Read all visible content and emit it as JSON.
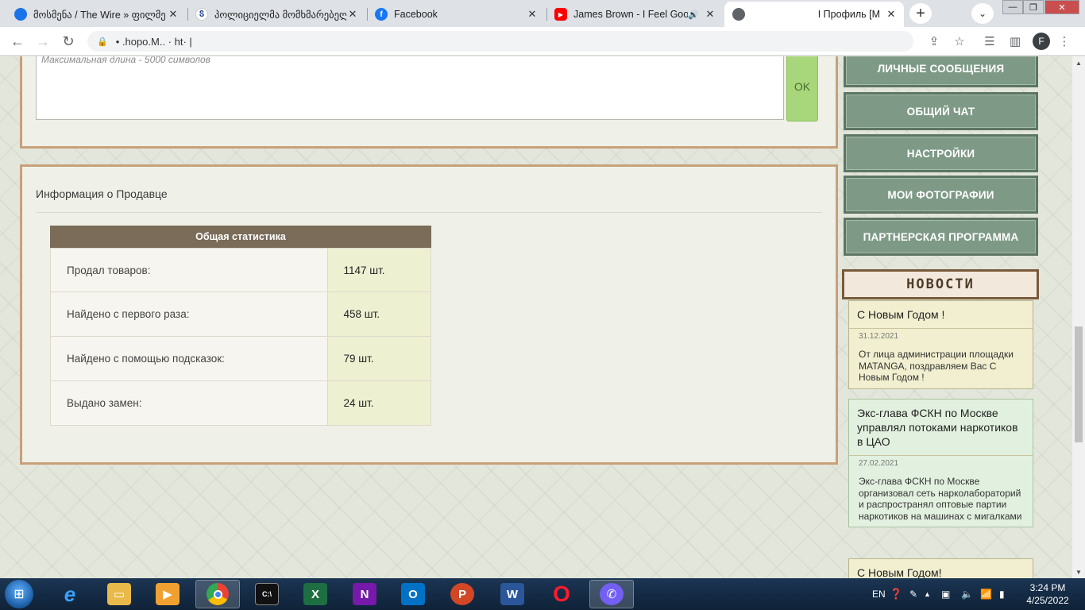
{
  "browser": {
    "tabs": [
      {
        "title": "მოსმენა / The Wire » ფილმე",
        "favicon_color": "#1a73e8",
        "favicon_glyph": "●"
      },
      {
        "title": "პოლიციელმა მომხმარებელ",
        "favicon_color": "#ffffff",
        "favicon_glyph": "Ⴝ"
      },
      {
        "title": "Facebook",
        "favicon_color": "#1877f2",
        "favicon_glyph": "f"
      },
      {
        "title": "James Brown - I Feel Good",
        "favicon_color": "#ff0000",
        "favicon_glyph": "▶"
      },
      {
        "title": "I Профиль [M",
        "favicon_color": "#5f6368",
        "favicon_glyph": "◍"
      }
    ],
    "tab_close_glyph": "✕",
    "audio_glyph": "🔊",
    "address": "• .hopo.M.. · ht· |",
    "new_tab_glyph": "+",
    "tab_search_glyph": "⌄",
    "profile_initial": "F",
    "window_controls": {
      "minimize": "—",
      "maximize": "❐",
      "close": "✕"
    }
  },
  "form": {
    "comment_placeholder": "Максимальная длина - 5000 символов",
    "ok_label": "OK"
  },
  "seller_info": {
    "title": "Информация о Продавце",
    "stats_header": "Общая статистика",
    "stats": [
      {
        "label": "Продал товаров:",
        "value": "1147 шт."
      },
      {
        "label": "Найдено с первого раза:",
        "value": "458 шт."
      },
      {
        "label": "Найдено с помощью подсказок:",
        "value": "79 шт."
      },
      {
        "label": "Выдано замен:",
        "value": "24 шт."
      }
    ]
  },
  "sidebar": {
    "menu": [
      {
        "label": "ЛИЧНЫЕ СООБЩЕНИЯ"
      },
      {
        "label": "ОБЩИЙ ЧАТ"
      },
      {
        "label": "НАСТРОЙКИ"
      },
      {
        "label": "МОИ ФОТОГРАФИИ"
      },
      {
        "label": "ПАРТНЕРСКАЯ ПРОГРАММА"
      }
    ],
    "news_title": "НОВОСТИ",
    "news": [
      {
        "title": "С Новым Годом !",
        "date": "31.12.2021",
        "text": "От лица администрации площадки MATANGA, поздравляем Вас С Новым Годом !"
      },
      {
        "title": "Экс-глава ФСКН по Москве управлял потоками наркотиков в ЦАО",
        "date": "27.02.2021",
        "text": "Экс-глава ФСКН по Москве организовал сеть нарколабораторий и распространял оптовые партии наркотиков на машинах с мигалками"
      },
      {
        "title": "С Новым Годом!",
        "date": "",
        "text": ""
      }
    ]
  },
  "taskbar": {
    "apps": [
      {
        "name": "internet-explorer",
        "color": "#1e88e5",
        "glyph": "e"
      },
      {
        "name": "file-explorer",
        "color": "#e9b949",
        "glyph": "▭"
      },
      {
        "name": "media-player",
        "color": "#f0a030",
        "glyph": "▶"
      },
      {
        "name": "chrome",
        "color": "#4285f4",
        "glyph": "◉"
      },
      {
        "name": "command-prompt",
        "color": "#111111",
        "glyph": "C:\\"
      },
      {
        "name": "excel",
        "color": "#1d6f42",
        "glyph": "X"
      },
      {
        "name": "onenote",
        "color": "#7719aa",
        "glyph": "N"
      },
      {
        "name": "outlook",
        "color": "#0072c6",
        "glyph": "O"
      },
      {
        "name": "powerpoint",
        "color": "#d24726",
        "glyph": "P"
      },
      {
        "name": "word",
        "color": "#2b579a",
        "glyph": "W"
      },
      {
        "name": "opera",
        "color": "#ff1b2d",
        "glyph": "O"
      },
      {
        "name": "viber",
        "color": "#7360f2",
        "glyph": "✆"
      }
    ],
    "language": "EN",
    "time": "3:24 PM",
    "date": "4/25/2022"
  }
}
